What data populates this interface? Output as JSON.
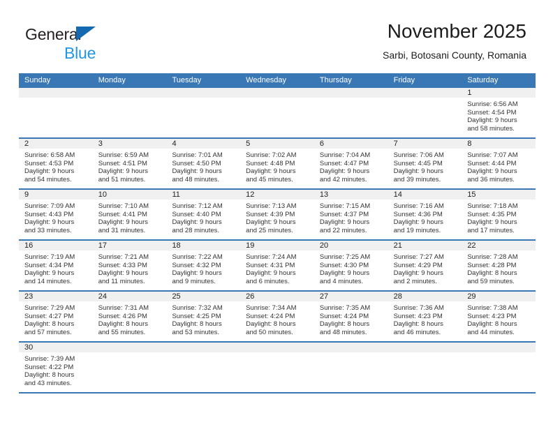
{
  "brand": {
    "name_part1": "General",
    "name_part2": "Blue",
    "accent_color": "#1469b0",
    "secondary_color": "#2196e8"
  },
  "header": {
    "title": "November 2025",
    "subtitle": "Sarbi, Botosani County, Romania"
  },
  "calendar": {
    "header_color": "#3a78b5",
    "weekdays": [
      "Sunday",
      "Monday",
      "Tuesday",
      "Wednesday",
      "Thursday",
      "Friday",
      "Saturday"
    ],
    "weeks": [
      [
        {
          "day": "",
          "sunrise": "",
          "sunset": "",
          "daylight1": "",
          "daylight2": ""
        },
        {
          "day": "",
          "sunrise": "",
          "sunset": "",
          "daylight1": "",
          "daylight2": ""
        },
        {
          "day": "",
          "sunrise": "",
          "sunset": "",
          "daylight1": "",
          "daylight2": ""
        },
        {
          "day": "",
          "sunrise": "",
          "sunset": "",
          "daylight1": "",
          "daylight2": ""
        },
        {
          "day": "",
          "sunrise": "",
          "sunset": "",
          "daylight1": "",
          "daylight2": ""
        },
        {
          "day": "",
          "sunrise": "",
          "sunset": "",
          "daylight1": "",
          "daylight2": ""
        },
        {
          "day": "1",
          "sunrise": "Sunrise: 6:56 AM",
          "sunset": "Sunset: 4:54 PM",
          "daylight1": "Daylight: 9 hours",
          "daylight2": "and 58 minutes."
        }
      ],
      [
        {
          "day": "2",
          "sunrise": "Sunrise: 6:58 AM",
          "sunset": "Sunset: 4:53 PM",
          "daylight1": "Daylight: 9 hours",
          "daylight2": "and 54 minutes."
        },
        {
          "day": "3",
          "sunrise": "Sunrise: 6:59 AM",
          "sunset": "Sunset: 4:51 PM",
          "daylight1": "Daylight: 9 hours",
          "daylight2": "and 51 minutes."
        },
        {
          "day": "4",
          "sunrise": "Sunrise: 7:01 AM",
          "sunset": "Sunset: 4:50 PM",
          "daylight1": "Daylight: 9 hours",
          "daylight2": "and 48 minutes."
        },
        {
          "day": "5",
          "sunrise": "Sunrise: 7:02 AM",
          "sunset": "Sunset: 4:48 PM",
          "daylight1": "Daylight: 9 hours",
          "daylight2": "and 45 minutes."
        },
        {
          "day": "6",
          "sunrise": "Sunrise: 7:04 AM",
          "sunset": "Sunset: 4:47 PM",
          "daylight1": "Daylight: 9 hours",
          "daylight2": "and 42 minutes."
        },
        {
          "day": "7",
          "sunrise": "Sunrise: 7:06 AM",
          "sunset": "Sunset: 4:45 PM",
          "daylight1": "Daylight: 9 hours",
          "daylight2": "and 39 minutes."
        },
        {
          "day": "8",
          "sunrise": "Sunrise: 7:07 AM",
          "sunset": "Sunset: 4:44 PM",
          "daylight1": "Daylight: 9 hours",
          "daylight2": "and 36 minutes."
        }
      ],
      [
        {
          "day": "9",
          "sunrise": "Sunrise: 7:09 AM",
          "sunset": "Sunset: 4:43 PM",
          "daylight1": "Daylight: 9 hours",
          "daylight2": "and 33 minutes."
        },
        {
          "day": "10",
          "sunrise": "Sunrise: 7:10 AM",
          "sunset": "Sunset: 4:41 PM",
          "daylight1": "Daylight: 9 hours",
          "daylight2": "and 31 minutes."
        },
        {
          "day": "11",
          "sunrise": "Sunrise: 7:12 AM",
          "sunset": "Sunset: 4:40 PM",
          "daylight1": "Daylight: 9 hours",
          "daylight2": "and 28 minutes."
        },
        {
          "day": "12",
          "sunrise": "Sunrise: 7:13 AM",
          "sunset": "Sunset: 4:39 PM",
          "daylight1": "Daylight: 9 hours",
          "daylight2": "and 25 minutes."
        },
        {
          "day": "13",
          "sunrise": "Sunrise: 7:15 AM",
          "sunset": "Sunset: 4:37 PM",
          "daylight1": "Daylight: 9 hours",
          "daylight2": "and 22 minutes."
        },
        {
          "day": "14",
          "sunrise": "Sunrise: 7:16 AM",
          "sunset": "Sunset: 4:36 PM",
          "daylight1": "Daylight: 9 hours",
          "daylight2": "and 19 minutes."
        },
        {
          "day": "15",
          "sunrise": "Sunrise: 7:18 AM",
          "sunset": "Sunset: 4:35 PM",
          "daylight1": "Daylight: 9 hours",
          "daylight2": "and 17 minutes."
        }
      ],
      [
        {
          "day": "16",
          "sunrise": "Sunrise: 7:19 AM",
          "sunset": "Sunset: 4:34 PM",
          "daylight1": "Daylight: 9 hours",
          "daylight2": "and 14 minutes."
        },
        {
          "day": "17",
          "sunrise": "Sunrise: 7:21 AM",
          "sunset": "Sunset: 4:33 PM",
          "daylight1": "Daylight: 9 hours",
          "daylight2": "and 11 minutes."
        },
        {
          "day": "18",
          "sunrise": "Sunrise: 7:22 AM",
          "sunset": "Sunset: 4:32 PM",
          "daylight1": "Daylight: 9 hours",
          "daylight2": "and 9 minutes."
        },
        {
          "day": "19",
          "sunrise": "Sunrise: 7:24 AM",
          "sunset": "Sunset: 4:31 PM",
          "daylight1": "Daylight: 9 hours",
          "daylight2": "and 6 minutes."
        },
        {
          "day": "20",
          "sunrise": "Sunrise: 7:25 AM",
          "sunset": "Sunset: 4:30 PM",
          "daylight1": "Daylight: 9 hours",
          "daylight2": "and 4 minutes."
        },
        {
          "day": "21",
          "sunrise": "Sunrise: 7:27 AM",
          "sunset": "Sunset: 4:29 PM",
          "daylight1": "Daylight: 9 hours",
          "daylight2": "and 2 minutes."
        },
        {
          "day": "22",
          "sunrise": "Sunrise: 7:28 AM",
          "sunset": "Sunset: 4:28 PM",
          "daylight1": "Daylight: 8 hours",
          "daylight2": "and 59 minutes."
        }
      ],
      [
        {
          "day": "23",
          "sunrise": "Sunrise: 7:29 AM",
          "sunset": "Sunset: 4:27 PM",
          "daylight1": "Daylight: 8 hours",
          "daylight2": "and 57 minutes."
        },
        {
          "day": "24",
          "sunrise": "Sunrise: 7:31 AM",
          "sunset": "Sunset: 4:26 PM",
          "daylight1": "Daylight: 8 hours",
          "daylight2": "and 55 minutes."
        },
        {
          "day": "25",
          "sunrise": "Sunrise: 7:32 AM",
          "sunset": "Sunset: 4:25 PM",
          "daylight1": "Daylight: 8 hours",
          "daylight2": "and 53 minutes."
        },
        {
          "day": "26",
          "sunrise": "Sunrise: 7:34 AM",
          "sunset": "Sunset: 4:24 PM",
          "daylight1": "Daylight: 8 hours",
          "daylight2": "and 50 minutes."
        },
        {
          "day": "27",
          "sunrise": "Sunrise: 7:35 AM",
          "sunset": "Sunset: 4:24 PM",
          "daylight1": "Daylight: 8 hours",
          "daylight2": "and 48 minutes."
        },
        {
          "day": "28",
          "sunrise": "Sunrise: 7:36 AM",
          "sunset": "Sunset: 4:23 PM",
          "daylight1": "Daylight: 8 hours",
          "daylight2": "and 46 minutes."
        },
        {
          "day": "29",
          "sunrise": "Sunrise: 7:38 AM",
          "sunset": "Sunset: 4:23 PM",
          "daylight1": "Daylight: 8 hours",
          "daylight2": "and 44 minutes."
        }
      ],
      [
        {
          "day": "30",
          "sunrise": "Sunrise: 7:39 AM",
          "sunset": "Sunset: 4:22 PM",
          "daylight1": "Daylight: 8 hours",
          "daylight2": "and 43 minutes."
        },
        {
          "day": "",
          "sunrise": "",
          "sunset": "",
          "daylight1": "",
          "daylight2": ""
        },
        {
          "day": "",
          "sunrise": "",
          "sunset": "",
          "daylight1": "",
          "daylight2": ""
        },
        {
          "day": "",
          "sunrise": "",
          "sunset": "",
          "daylight1": "",
          "daylight2": ""
        },
        {
          "day": "",
          "sunrise": "",
          "sunset": "",
          "daylight1": "",
          "daylight2": ""
        },
        {
          "day": "",
          "sunrise": "",
          "sunset": "",
          "daylight1": "",
          "daylight2": ""
        },
        {
          "day": "",
          "sunrise": "",
          "sunset": "",
          "daylight1": "",
          "daylight2": ""
        }
      ]
    ]
  }
}
